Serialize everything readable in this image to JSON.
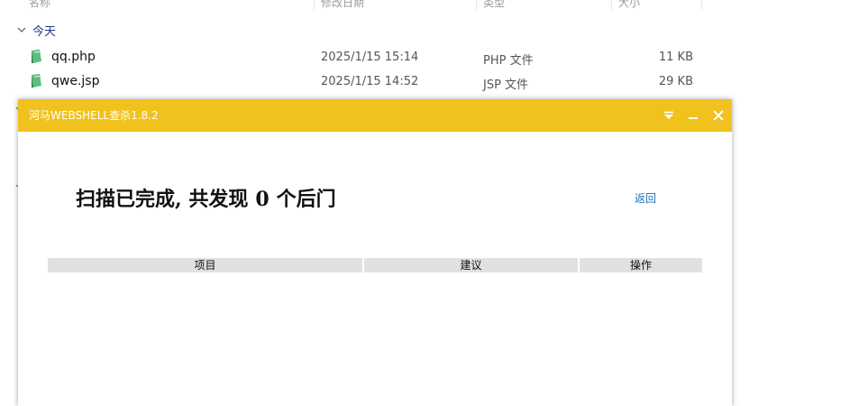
{
  "explorer": {
    "columns": {
      "name": "名称",
      "date": "修改日期",
      "type": "类型",
      "size": "大小"
    },
    "group_label": "今天",
    "files": [
      {
        "name": "qq.php",
        "date": "2025/1/15 15:14",
        "type": "PHP 文件",
        "size": "11 KB",
        "icon": "php-file-icon"
      },
      {
        "name": "qwe.jsp",
        "date": "2025/1/15 14:52",
        "type": "JSP 文件",
        "size": "29 KB",
        "icon": "jsp-file-icon"
      }
    ]
  },
  "scanner": {
    "title": "河马WEBSHELL查杀1.8.2",
    "result_prefix": "扫描已完成, 共发现",
    "result_count": "0",
    "result_suffix": "个后门",
    "back_label": "返回",
    "table_headers": {
      "item": "项目",
      "suggestion": "建议",
      "action": "操作"
    },
    "accent_color": "#f1c21e"
  }
}
